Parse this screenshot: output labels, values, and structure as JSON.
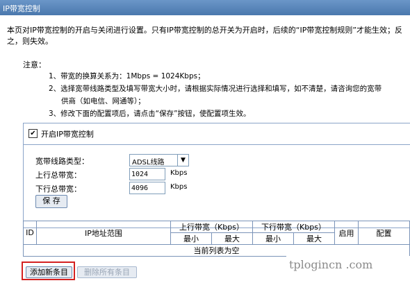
{
  "window": {
    "title": "IP带宽控制"
  },
  "intro": "本页对IP带宽控制的开启与关闭进行设置。只有IP带宽控制的总开关为开启时，后续的“IP带宽控制规则”才能生效；反之，则失效。",
  "notes": {
    "title": "注意：",
    "items": [
      "1、带宽的换算关系为：1Mbps = 1024Kbps；",
      "2、选择宽带线路类型及填写带宽大小时，请根据实际情况进行选择和填写，如不清楚，请咨询您的宽带",
      "供商（如电信、网通等）；",
      "3、修改下面的配置项后，请点击“保存”按钮，使配置项生效。"
    ]
  },
  "control": {
    "enable_label": "开启IP带宽控制",
    "enabled": true,
    "line_type_label": "宽带线路类型：",
    "line_type_value": "ADSL线路",
    "up_label": "上行总带宽：",
    "up_value": "1024",
    "down_label": "下行总带宽：",
    "down_value": "4096",
    "unit": "Kbps",
    "save_label": "保 存"
  },
  "table": {
    "headers": {
      "id": "ID",
      "ip_range": "IP地址范围",
      "up": "上行带宽（Kbps）",
      "down": "下行带宽（Kbps）",
      "enable": "启用",
      "config": "配置",
      "min": "最小",
      "max": "最大"
    },
    "empty_text": "当前列表为空"
  },
  "buttons": {
    "add_label": "添加新条目",
    "delete_all_label": "删除所有条目"
  },
  "watermark": "tplogincn .com",
  "colors": {
    "title_bar": "#4a78ad",
    "highlight": "#d42020"
  }
}
